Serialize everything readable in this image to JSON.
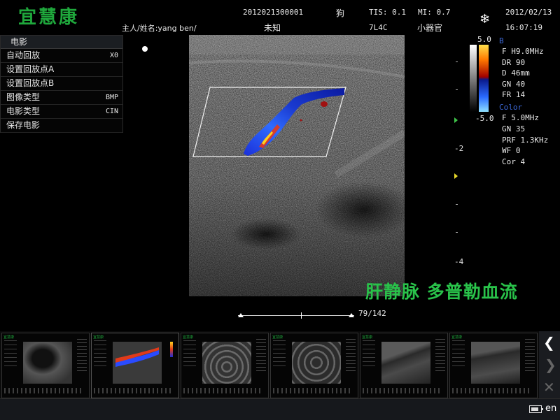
{
  "logo": "宜慧康",
  "header": {
    "patient_id": "2012021300001",
    "species": "狗",
    "tis": "TIS: 0.1",
    "mi": "MI: 0.7",
    "date": "2012/02/13",
    "owner_label": "主人/姓名:yang ben/",
    "unknown": "未知",
    "probe": "7L4C",
    "preset": "小器官",
    "time": "16:07:19",
    "freeze_icon": "snowflake-icon"
  },
  "cine_menu": {
    "title": "电影",
    "items": [
      {
        "label": "自动回放",
        "value": "X0"
      },
      {
        "label": "设置回放点A",
        "value": ""
      },
      {
        "label": "设置回放点B",
        "value": ""
      },
      {
        "label": "图像类型",
        "value": "BMP"
      },
      {
        "label": "电影类型",
        "value": "CIN"
      },
      {
        "label": "保存电影",
        "value": ""
      }
    ]
  },
  "color_scale": {
    "top": "5.0",
    "bottom": "-5.0"
  },
  "b_params": {
    "title": "B",
    "lines": [
      "F   H9.0MHz",
      "DR  90",
      "D   46mm",
      "GN  40",
      "FR  14"
    ]
  },
  "color_params": {
    "title": "Color",
    "lines": [
      "F   5.0MHz",
      "GN  35",
      "PRF 1.3KHz",
      "WF  0",
      "Cor 4"
    ]
  },
  "depth_labels": [
    "-2",
    "-4"
  ],
  "annotation": "肝静脉 多普勒血流",
  "cine": {
    "frame": "79/142"
  },
  "thumbnails": [
    {
      "label": "宜慧康",
      "kind": "b"
    },
    {
      "label": "宜慧康",
      "kind": "color"
    },
    {
      "label": "宜慧康",
      "kind": "b"
    },
    {
      "label": "宜慧康",
      "kind": "b"
    },
    {
      "label": "宜慧康",
      "kind": "b"
    },
    {
      "label": "宜慧康",
      "kind": "b"
    }
  ],
  "nav": {
    "prev_icon": "chevron-left-icon",
    "next_icon": "chevron-right-icon",
    "delete_icon": "close-icon"
  },
  "status": {
    "battery_icon": "battery-icon",
    "language": "en"
  },
  "colors": {
    "brand_green": "#1fa83c",
    "banner_green": "#29c24a",
    "scale_b_label": "#3b66d4"
  }
}
